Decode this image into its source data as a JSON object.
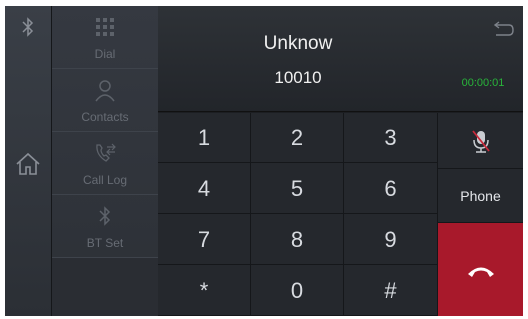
{
  "rail": {
    "top_icon": "bluetooth-icon",
    "home_icon": "home-icon"
  },
  "nav": {
    "items": [
      {
        "label": "Dial",
        "icon": "dialpad-icon"
      },
      {
        "label": "Contacts",
        "icon": "person-icon"
      },
      {
        "label": "Call Log",
        "icon": "call-log-icon"
      },
      {
        "label": "BT Set",
        "icon": "bluetooth-icon"
      }
    ]
  },
  "call": {
    "name": "Unknow",
    "number": "10010",
    "duration": "00:00:01",
    "back_icon": "back-icon"
  },
  "keypad": {
    "keys": [
      "1",
      "2",
      "3",
      "4",
      "5",
      "6",
      "7",
      "8",
      "9",
      "*",
      "0",
      "#"
    ]
  },
  "side": {
    "mute_icon": "mic-muted-icon",
    "phone_label": "Phone",
    "hangup_icon": "hang-up-icon"
  },
  "colors": {
    "timer": "#28b43a",
    "hangup": "#a8192b",
    "background": "#1c1e22"
  }
}
